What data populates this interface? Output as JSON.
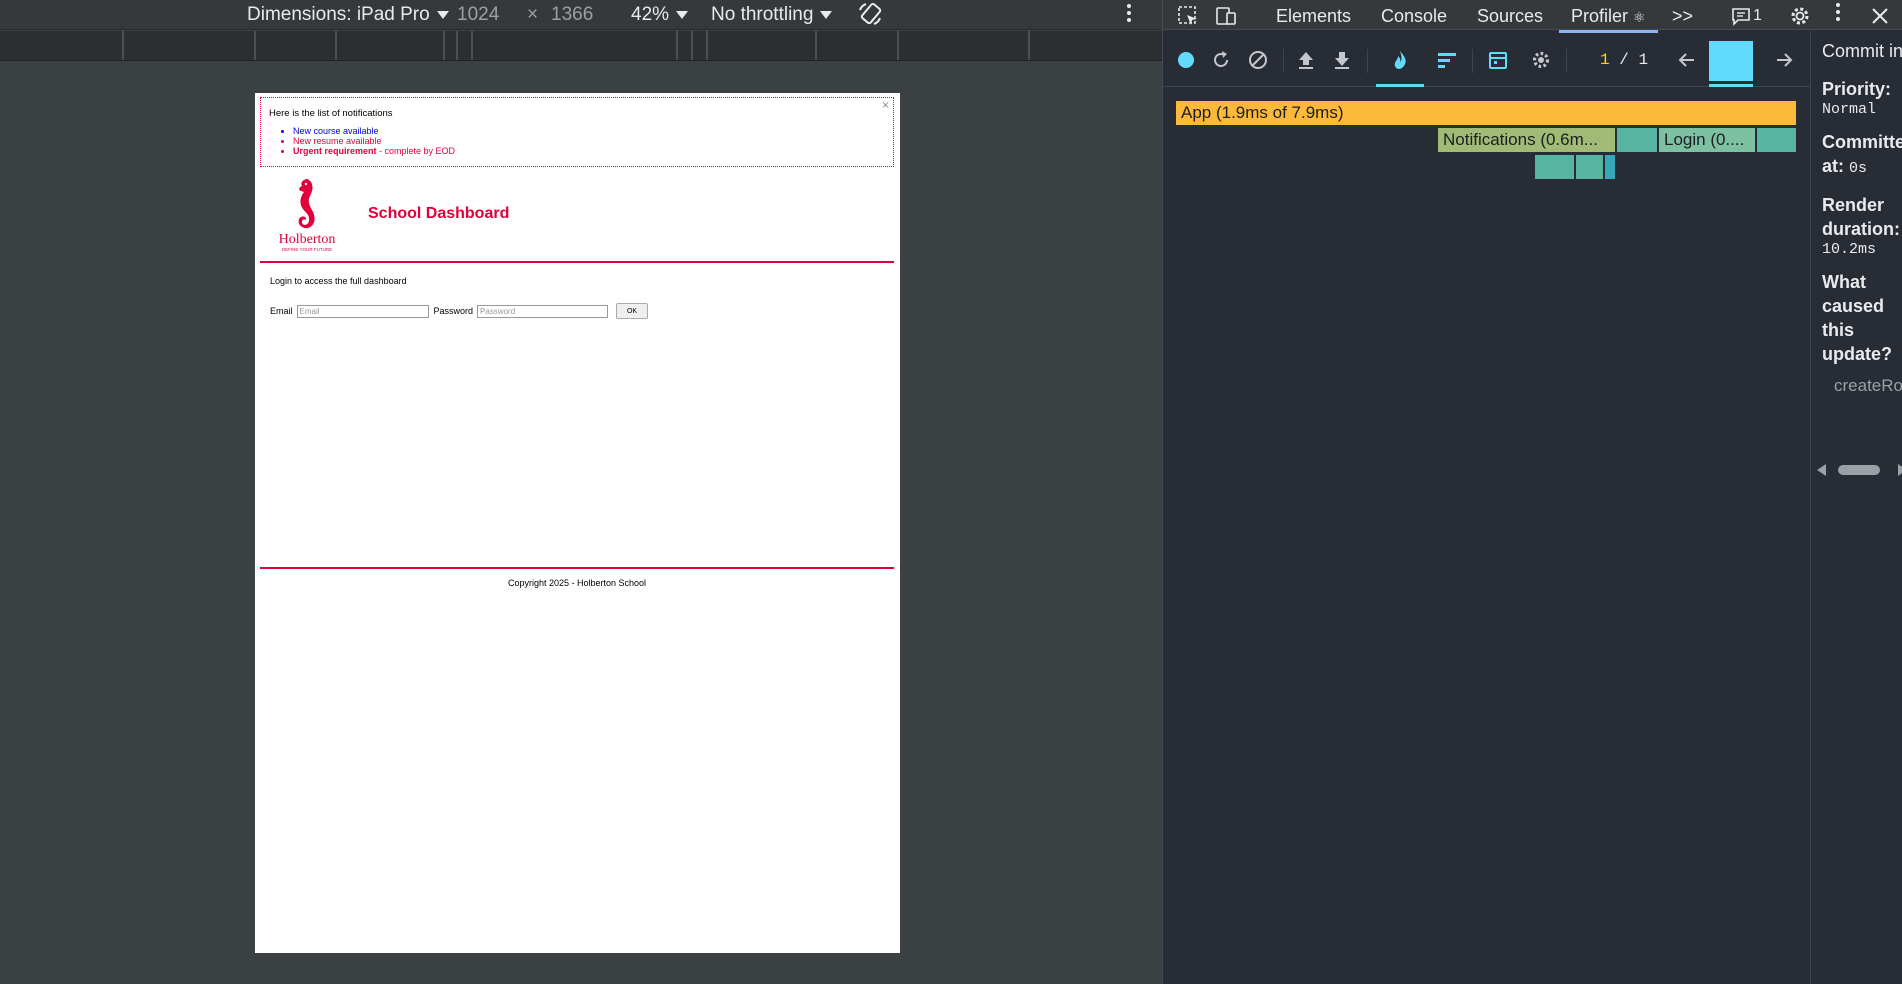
{
  "device_toolbar": {
    "dimensions_label": "Dimensions: iPad Pro",
    "width": "1024",
    "times": "×",
    "height": "1366",
    "zoom": "42%",
    "throttling": "No throttling"
  },
  "page": {
    "notifications": {
      "close": "×",
      "title": "Here is the list of notifications",
      "items": [
        {
          "text": "New course available",
          "type": "default"
        },
        {
          "text": "New resume available",
          "type": "urgent"
        }
      ],
      "urgent_bold": "Urgent requirement",
      "urgent_rest": " - complete by EOD"
    },
    "header": {
      "title": "School Dashboard",
      "logo_text": "Holberton",
      "logo_tagline": "DEFINE YOUR FUTURE"
    },
    "login": {
      "intro": "Login to access the full dashboard",
      "email_label": "Email",
      "email_placeholder": "Email",
      "password_label": "Password",
      "password_placeholder": "Password",
      "ok": "OK"
    },
    "footer": {
      "copyright": "Copyright 2025 - Holberton School"
    }
  },
  "devtools": {
    "tabs": [
      "Elements",
      "Console",
      "Sources",
      "Profiler"
    ],
    "active_tab": "Profiler",
    "more": ">>",
    "issues_count": "1",
    "profiler": {
      "commit_current": "1",
      "commit_sep": "/",
      "commit_total": "1",
      "flame": [
        {
          "label": "App (1.9ms of 7.9ms)",
          "color": "#fdb93a"
        },
        {
          "label": "Notifications (0.6m...",
          "color": "#9fbb76"
        },
        {
          "label": "",
          "color": "#56b4a0"
        },
        {
          "label": "Login (0....",
          "color": "#7ec0a2"
        },
        {
          "label": "",
          "color": "#56b4a0"
        },
        {
          "label": "",
          "color": "#56b4a0"
        },
        {
          "label": "",
          "color": "#56b4a0"
        },
        {
          "label": "",
          "color": "#37a8b9"
        }
      ]
    },
    "sidebar": {
      "heading": "Commit information",
      "priority_label": "Priority",
      "priority_value": "Normal",
      "committed_label": "Committed at",
      "committed_value": "0s",
      "render_label": "Render duration",
      "render_value": "10.2ms",
      "cause_label": "What caused this update?",
      "cause_value": "createRoot()"
    }
  },
  "colors": {
    "accent": "#e1003c",
    "react_blue": "#61dafb",
    "devtools_bg": "#282c34",
    "emulation_bg": "#3b4043"
  }
}
